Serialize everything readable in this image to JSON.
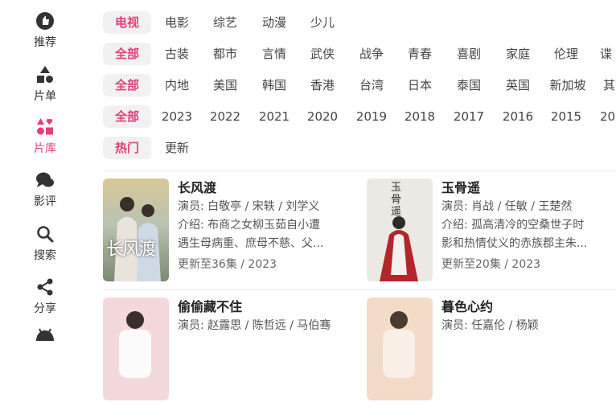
{
  "nav": [
    {
      "label": "推荐"
    },
    {
      "label": "片单"
    },
    {
      "label": "片库"
    },
    {
      "label": "影评"
    },
    {
      "label": "搜索"
    },
    {
      "label": "分享"
    }
  ],
  "filters": {
    "rows": [
      {
        "items": [
          "电视",
          "电影",
          "综艺",
          "动漫",
          "少儿"
        ]
      },
      {
        "items": [
          "全部",
          "古装",
          "都市",
          "言情",
          "武侠",
          "战争",
          "青春",
          "喜剧",
          "家庭",
          "伦理",
          "谍"
        ]
      },
      {
        "items": [
          "全部",
          "内地",
          "美国",
          "韩国",
          "香港",
          "台湾",
          "日本",
          "泰国",
          "英国",
          "新加坡",
          "其"
        ]
      },
      {
        "items": [
          "全部",
          "2023",
          "2022",
          "2021",
          "2020",
          "2019",
          "2018",
          "2017",
          "2016",
          "2015",
          "20"
        ]
      },
      {
        "items": [
          "热门",
          "更新"
        ]
      }
    ]
  },
  "cards": [
    {
      "title": "长风渡",
      "cast": "演员: 白敬亭 / 宋轶 / 刘学义",
      "intro1": "介绍: 布商之女柳玉茹自小遭",
      "intro2": "遇生母病重、庶母不慈、父...",
      "meta": "更新至36集 / 2023",
      "poster_text": "长风渡"
    },
    {
      "title": "玉骨遥",
      "cast": "演员: 肖战 / 任敏 / 王楚然",
      "intro1": "介绍: 孤高清冷的空桑世子时",
      "intro2": "影和热情仗义的赤族郡主朱...",
      "meta": "更新至20集 / 2023",
      "poster_text": "玉骨遥"
    },
    {
      "title": "偷偷藏不住",
      "cast": "演员: 赵露思 / 陈哲远 / 马伯骞"
    },
    {
      "title": "暮色心约",
      "cast": "演员: 任嘉伦 / 杨颖"
    }
  ],
  "colors": {
    "accent": "#e0407a",
    "chip_bg": "#f1f1f1"
  }
}
